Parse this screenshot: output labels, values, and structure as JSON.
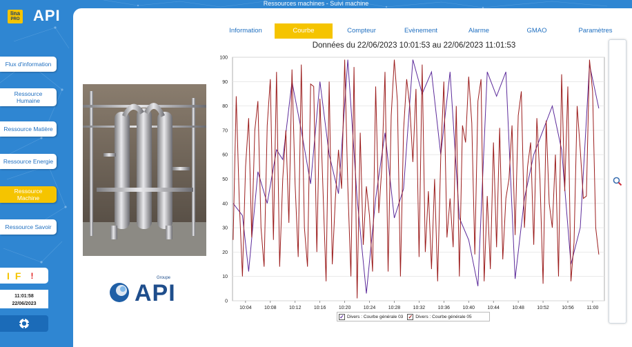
{
  "window": {
    "title": "Ressources machines - Suivi machine"
  },
  "branding": {
    "lina_text": "lina",
    "pro_text": "PRO",
    "api_text": "API",
    "groupe_text": "Groupe"
  },
  "sidebar": {
    "items": [
      {
        "label": "Flux d'information",
        "active": false
      },
      {
        "label": "Ressource Humaine",
        "active": false
      },
      {
        "label": "Ressource Matière",
        "active": false
      },
      {
        "label": "Ressource Energie",
        "active": false
      },
      {
        "label": "Ressource Machine",
        "active": true
      },
      {
        "label": "Ressource Savoir",
        "active": false
      }
    ],
    "status": {
      "i_label": "I",
      "f_label": "F",
      "alert_label": "!"
    },
    "clock": {
      "time": "11:01:58",
      "date": "22/06/2023"
    }
  },
  "tabs": [
    {
      "label": "Information",
      "active": false
    },
    {
      "label": "Courbe",
      "active": true
    },
    {
      "label": "Compteur",
      "active": false
    },
    {
      "label": "Evènement",
      "active": false
    },
    {
      "label": "Alarme",
      "active": false
    },
    {
      "label": "GMAO",
      "active": false
    },
    {
      "label": "Paramètres",
      "active": false
    }
  ],
  "colors": {
    "accent": "#f5c400",
    "brand_blue": "#2f86d2",
    "series_1": "#5b2a9a",
    "series_2": "#9b1c1c"
  },
  "chart_data": {
    "type": "line",
    "title": "Données du 22/06/2023 10:01:53 au 22/06/2023 11:01:53",
    "xlabel": "",
    "ylabel": "",
    "ylim": [
      0,
      100
    ],
    "y_ticks": [
      0,
      10,
      20,
      30,
      40,
      50,
      60,
      70,
      80,
      90,
      100
    ],
    "x_ticks": [
      "10:04",
      "10:08",
      "10:12",
      "10:16",
      "10:20",
      "10:24",
      "10:28",
      "10:32",
      "10:36",
      "10:40",
      "10:44",
      "10:48",
      "10:52",
      "10:56",
      "11:00"
    ],
    "x_range_minutes": [
      1.9,
      61.9
    ],
    "grid": true,
    "legend_position": "bottom",
    "series": [
      {
        "name": "Divers : Courbe générale 03",
        "x": [
          2,
          3.5,
          4.5,
          6,
          7.5,
          9,
          10,
          11.5,
          13,
          14.5,
          16,
          17.5,
          19,
          20.5,
          22,
          23.5,
          25,
          26.5,
          28,
          29.5,
          31,
          32.5,
          34,
          35.5,
          37,
          38.5,
          40,
          41.5,
          43,
          44.5,
          46,
          47.5,
          49,
          50.5,
          52,
          53.5,
          55,
          56.5,
          58,
          59.5,
          61
        ],
        "values": [
          40,
          35,
          12,
          53,
          40,
          62,
          58,
          90,
          70,
          48,
          90,
          60,
          44,
          99,
          42,
          3,
          42,
          69,
          34,
          46,
          99,
          85,
          94,
          60,
          94,
          34,
          25,
          6,
          94,
          84,
          94,
          9,
          42,
          60,
          70,
          80,
          62,
          15,
          30,
          97,
          79
        ]
      },
      {
        "name": "Divers : Courbe générale 05",
        "x": [
          2,
          2.5,
          3,
          3.5,
          4,
          4.5,
          5,
          5.5,
          6,
          6.5,
          7,
          7.5,
          8,
          8.5,
          9,
          9.5,
          10,
          10.5,
          11,
          11.5,
          12,
          12.5,
          13,
          13.5,
          14,
          14.5,
          15,
          15.5,
          16,
          16.5,
          17,
          17.5,
          18,
          18.5,
          19,
          19.5,
          20,
          20.5,
          21,
          21.5,
          22,
          22.5,
          23,
          23.5,
          24,
          24.5,
          25,
          25.5,
          26,
          26.5,
          27,
          27.5,
          28,
          28.5,
          29,
          29.5,
          30,
          30.5,
          31,
          31.5,
          32,
          32.5,
          33,
          33.5,
          34,
          34.5,
          35,
          35.5,
          36,
          36.5,
          37,
          37.5,
          38,
          38.5,
          39,
          39.5,
          40,
          40.5,
          41,
          41.5,
          42,
          42.5,
          43,
          43.5,
          44,
          44.5,
          45,
          45.5,
          46,
          46.5,
          47,
          47.5,
          48,
          48.5,
          49,
          49.5,
          50,
          50.5,
          51,
          51.5,
          52,
          52.5,
          53,
          53.5,
          54,
          54.5,
          55,
          55.5,
          56,
          56.5,
          57,
          57.5,
          58,
          58.5,
          59,
          59.5,
          60,
          60.5,
          61
        ],
        "values": [
          25,
          84,
          40,
          10,
          55,
          75,
          26,
          70,
          82,
          30,
          14,
          72,
          91,
          25,
          94,
          14,
          50,
          70,
          32,
          95,
          48,
          18,
          97,
          30,
          14,
          89,
          88,
          20,
          83,
          45,
          8,
          90,
          15,
          42,
          62,
          46,
          99,
          47,
          10,
          96,
          1,
          69,
          23,
          47,
          35,
          12,
          88,
          36,
          55,
          94,
          12,
          76,
          99,
          82,
          10,
          70,
          91,
          80,
          57,
          87,
          18,
          97,
          20,
          45,
          13,
          50,
          8,
          59,
          90,
          26,
          42,
          22,
          80,
          10,
          72,
          65,
          92,
          73,
          19,
          82,
          91,
          8,
          43,
          13,
          65,
          22,
          71,
          17,
          42,
          50,
          72,
          27,
          76,
          86,
          30,
          55,
          65,
          23,
          75,
          50,
          7,
          74,
          40,
          30,
          60,
          10,
          93,
          45,
          88,
          8,
          24,
          80,
          62,
          42,
          43,
          99,
          86,
          30,
          19
        ]
      }
    ]
  }
}
